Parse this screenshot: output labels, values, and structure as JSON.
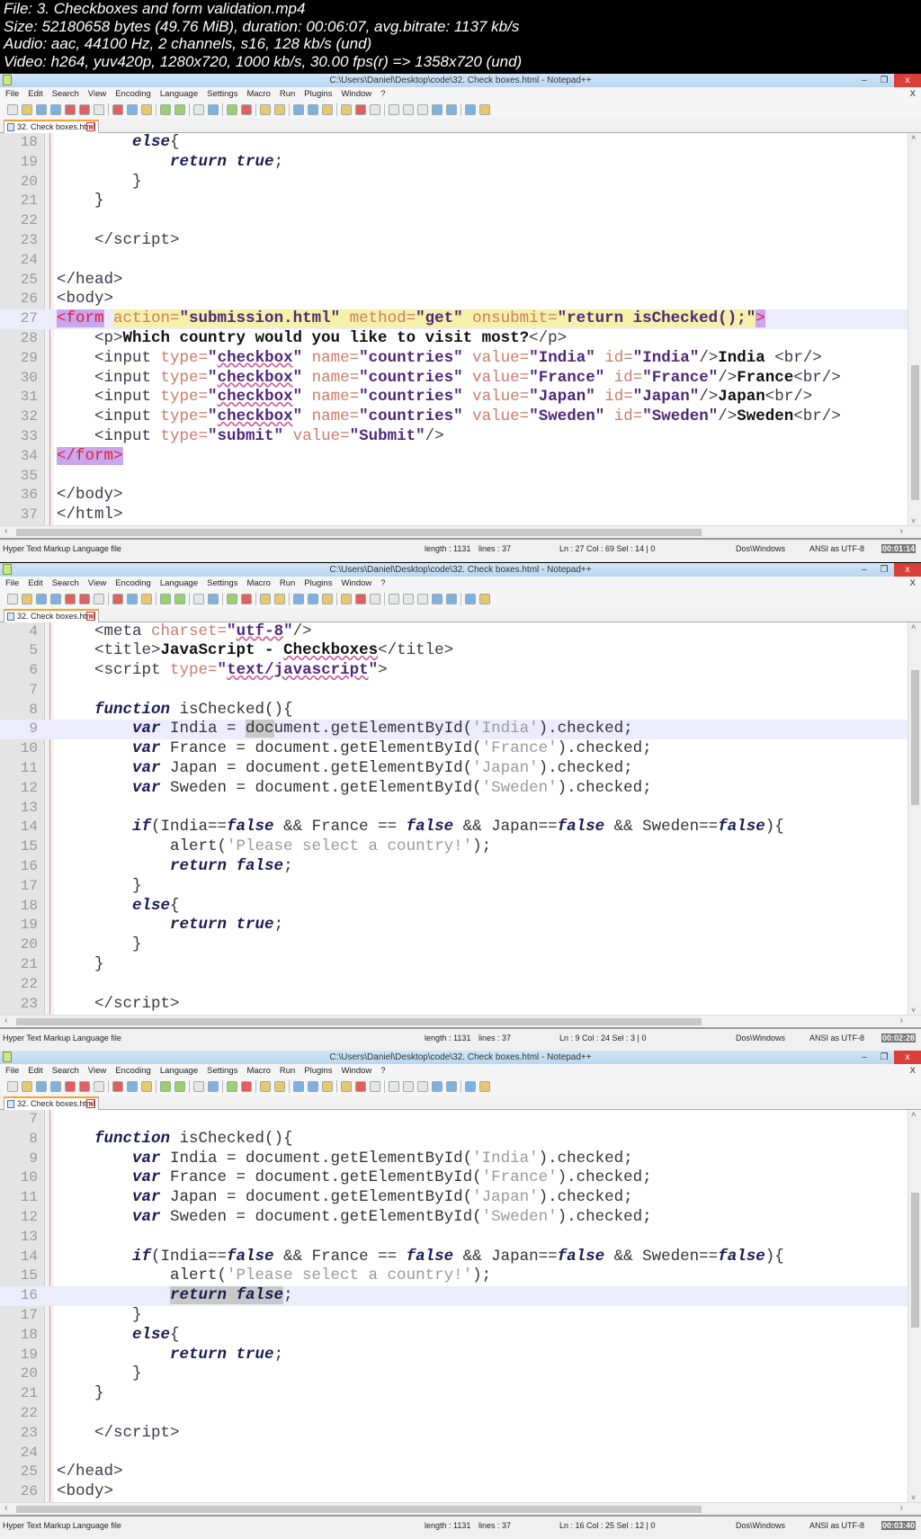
{
  "header": [
    "File: 3. Checkboxes and form validation.mp4",
    "Size: 52180658 bytes (49.76 MiB), duration: 00:06:07, avg.bitrate: 1137 kb/s",
    "Audio: aac, 44100 Hz, 2 channels, s16, 128 kb/s (und)",
    "Video: h264, yuv420p, 1280x720, 1000 kb/s, 30.00 fps(r) => 1358x720 (und)"
  ],
  "window": {
    "title": "C:\\Users\\Daniel\\Desktop\\code\\32. Check boxes.html - Notepad++",
    "minimize": "–",
    "restore": "❐",
    "close": "x",
    "menu": [
      "File",
      "Edit",
      "Search",
      "View",
      "Encoding",
      "Language",
      "Settings",
      "Macro",
      "Run",
      "Plugins",
      "Window",
      "?"
    ],
    "menu_close": "X",
    "tab": "32. Check boxes.html",
    "tab_close": "x"
  },
  "panels": [
    {
      "first_line": 18,
      "current_line": 27,
      "vscroll_fraction": 0.95,
      "status": {
        "type": "Hyper Text Markup Language file",
        "length": "length : 1131",
        "lines": "lines : 37",
        "pos": "Ln : 27   Col : 69   Sel : 14 | 0",
        "eol": "Dos\\Windows",
        "enc": "ANSI as UTF-8",
        "time": "00:01:14"
      },
      "lines": [
        [
          [
            "p",
            "        "
          ],
          [
            "kw",
            "else"
          ],
          [
            "p",
            "{"
          ]
        ],
        [
          [
            "p",
            "            "
          ],
          [
            "kw",
            "return true"
          ],
          [
            "p",
            ";"
          ]
        ],
        [
          [
            "p",
            "        }"
          ]
        ],
        [
          [
            "p",
            "    }"
          ]
        ],
        [],
        [
          [
            "tag",
            "    </script>"
          ]
        ],
        [],
        [
          [
            "tag",
            "</head>"
          ]
        ],
        [
          [
            "tag",
            "<body>"
          ]
        ],
        [
          [
            "tagm",
            "<form"
          ],
          [
            "p",
            " "
          ],
          [
            "attr hl",
            "action="
          ],
          [
            "val hl",
            "\"submission.html\""
          ],
          [
            "hl",
            " "
          ],
          [
            "attr hl",
            "method="
          ],
          [
            "val hl",
            "\"get\""
          ],
          [
            "hl",
            " "
          ],
          [
            "attr hl",
            "onsubmit="
          ],
          [
            "val hl",
            "\"return isChecked();\""
          ],
          [
            "tagm",
            ">"
          ]
        ],
        [
          [
            "tag",
            "    <p>"
          ],
          [
            "txt",
            "Which country would you like to visit most?"
          ],
          [
            "tag",
            "</p>"
          ]
        ],
        [
          [
            "tag",
            "    <input "
          ],
          [
            "attr",
            "type="
          ],
          [
            "val",
            "\""
          ],
          [
            "valu",
            "checkbox"
          ],
          [
            "val",
            "\""
          ],
          [
            "p",
            " "
          ],
          [
            "attr",
            "name="
          ],
          [
            "val",
            "\"countries\""
          ],
          [
            "p",
            " "
          ],
          [
            "attr",
            "value="
          ],
          [
            "val",
            "\"India\""
          ],
          [
            "p",
            " "
          ],
          [
            "attr",
            "id="
          ],
          [
            "val",
            "\"India\""
          ],
          [
            "tag",
            "/>"
          ],
          [
            "txt",
            "India "
          ],
          [
            "tag",
            "<br/>"
          ]
        ],
        [
          [
            "tag",
            "    <input "
          ],
          [
            "attr",
            "type="
          ],
          [
            "val",
            "\""
          ],
          [
            "valu",
            "checkbox"
          ],
          [
            "val",
            "\""
          ],
          [
            "p",
            " "
          ],
          [
            "attr",
            "name="
          ],
          [
            "val",
            "\"countries\""
          ],
          [
            "p",
            " "
          ],
          [
            "attr",
            "value="
          ],
          [
            "val",
            "\"France\""
          ],
          [
            "p",
            " "
          ],
          [
            "attr",
            "id="
          ],
          [
            "val",
            "\"France\""
          ],
          [
            "tag",
            "/>"
          ],
          [
            "txt",
            "France"
          ],
          [
            "tag",
            "<br/>"
          ]
        ],
        [
          [
            "tag",
            "    <input "
          ],
          [
            "attr",
            "type="
          ],
          [
            "val",
            "\""
          ],
          [
            "valu",
            "checkbox"
          ],
          [
            "val",
            "\""
          ],
          [
            "p",
            " "
          ],
          [
            "attr",
            "name="
          ],
          [
            "val",
            "\"countries\""
          ],
          [
            "p",
            " "
          ],
          [
            "attr",
            "value="
          ],
          [
            "val",
            "\"Japan\""
          ],
          [
            "p",
            " "
          ],
          [
            "attr",
            "id="
          ],
          [
            "val",
            "\"Japan\""
          ],
          [
            "tag",
            "/>"
          ],
          [
            "txt",
            "Japan"
          ],
          [
            "tag",
            "<br/>"
          ]
        ],
        [
          [
            "tag",
            "    <input "
          ],
          [
            "attr",
            "type="
          ],
          [
            "val",
            "\""
          ],
          [
            "valu",
            "checkbox"
          ],
          [
            "val",
            "\""
          ],
          [
            "p",
            " "
          ],
          [
            "attr",
            "name="
          ],
          [
            "val",
            "\"countries\""
          ],
          [
            "p",
            " "
          ],
          [
            "attr",
            "value="
          ],
          [
            "val",
            "\"Sweden\""
          ],
          [
            "p",
            " "
          ],
          [
            "attr",
            "id="
          ],
          [
            "val",
            "\"Sweden\""
          ],
          [
            "tag",
            "/>"
          ],
          [
            "txt",
            "Sweden"
          ],
          [
            "tag",
            "<br/>"
          ]
        ],
        [
          [
            "tag",
            "    <input "
          ],
          [
            "attr",
            "type="
          ],
          [
            "val",
            "\"submit\""
          ],
          [
            "p",
            " "
          ],
          [
            "attr",
            "value="
          ],
          [
            "val",
            "\"Submit\""
          ],
          [
            "tag",
            "/>"
          ]
        ],
        [
          [
            "tagm",
            "</form>"
          ]
        ],
        [],
        [
          [
            "tag",
            "</body>"
          ]
        ],
        [
          [
            "tag",
            "</html>"
          ]
        ]
      ]
    },
    {
      "first_line": 4,
      "current_line": 9,
      "vscroll_fraction": 0.15,
      "status": {
        "type": "Hyper Text Markup Language file",
        "length": "length : 1131",
        "lines": "lines : 37",
        "pos": "Ln : 9   Col : 24   Sel : 3 | 0",
        "eol": "Dos\\Windows",
        "enc": "ANSI as UTF-8",
        "time": "00:02:28"
      },
      "lines": [
        [
          [
            "tag",
            "    <meta "
          ],
          [
            "attr",
            "charset="
          ],
          [
            "val",
            "\""
          ],
          [
            "valu",
            "utf-8"
          ],
          [
            "val",
            "\""
          ],
          [
            "tag",
            "/>"
          ]
        ],
        [
          [
            "tag",
            "    <title>"
          ],
          [
            "txt",
            "JavaScript - "
          ],
          [
            "txtu",
            "Checkboxes"
          ],
          [
            "tag",
            "</title>"
          ]
        ],
        [
          [
            "tag",
            "    <script "
          ],
          [
            "attr",
            "type="
          ],
          [
            "val",
            "\""
          ],
          [
            "valu",
            "text/javascript"
          ],
          [
            "val",
            "\""
          ],
          [
            "tag",
            ">"
          ]
        ],
        [],
        [
          [
            "p",
            "    "
          ],
          [
            "kw",
            "function"
          ],
          [
            "p",
            " isChecked(){"
          ]
        ],
        [
          [
            "p",
            "        "
          ],
          [
            "kw",
            "var"
          ],
          [
            "p",
            " India = "
          ],
          [
            "sel",
            "doc"
          ],
          [
            "p",
            "ument.getElementById("
          ],
          [
            "str",
            "'India'"
          ],
          [
            "p",
            ").checked;"
          ]
        ],
        [
          [
            "p",
            "        "
          ],
          [
            "kw",
            "var"
          ],
          [
            "p",
            " France = document.getElementById("
          ],
          [
            "str",
            "'France'"
          ],
          [
            "p",
            ").checked;"
          ]
        ],
        [
          [
            "p",
            "        "
          ],
          [
            "kw",
            "var"
          ],
          [
            "p",
            " Japan = document.getElementById("
          ],
          [
            "str",
            "'Japan'"
          ],
          [
            "p",
            ").checked;"
          ]
        ],
        [
          [
            "p",
            "        "
          ],
          [
            "kw",
            "var"
          ],
          [
            "p",
            " Sweden = document.getElementById("
          ],
          [
            "str",
            "'Sweden'"
          ],
          [
            "p",
            ").checked;"
          ]
        ],
        [],
        [
          [
            "p",
            "        "
          ],
          [
            "kw",
            "if"
          ],
          [
            "p",
            "(India=="
          ],
          [
            "kw",
            "false"
          ],
          [
            "p",
            " && France == "
          ],
          [
            "kw",
            "false"
          ],
          [
            "p",
            " && Japan=="
          ],
          [
            "kw",
            "false"
          ],
          [
            "p",
            " && Sweden=="
          ],
          [
            "kw",
            "false"
          ],
          [
            "p",
            "){"
          ]
        ],
        [
          [
            "p",
            "            alert("
          ],
          [
            "str",
            "'Please select a country!'"
          ],
          [
            "p",
            ");"
          ]
        ],
        [
          [
            "p",
            "            "
          ],
          [
            "kw",
            "return false"
          ],
          [
            "p",
            ";"
          ]
        ],
        [
          [
            "p",
            "        }"
          ]
        ],
        [
          [
            "p",
            "        "
          ],
          [
            "kw",
            "else"
          ],
          [
            "p",
            "{"
          ]
        ],
        [
          [
            "p",
            "            "
          ],
          [
            "kw",
            "return true"
          ],
          [
            "p",
            ";"
          ]
        ],
        [
          [
            "p",
            "        }"
          ]
        ],
        [
          [
            "p",
            "    }"
          ]
        ],
        [],
        [
          [
            "tag",
            "    </script>"
          ]
        ]
      ]
    },
    {
      "first_line": 7,
      "current_line": 16,
      "vscroll_fraction": 0.3,
      "status": {
        "type": "Hyper Text Markup Language file",
        "length": "length : 1131",
        "lines": "lines : 37",
        "pos": "Ln : 16   Col : 25   Sel : 12 | 0",
        "eol": "Dos\\Windows",
        "enc": "ANSI as UTF-8",
        "time": "00:03:40"
      },
      "lines": [
        [],
        [
          [
            "p",
            "    "
          ],
          [
            "kw",
            "function"
          ],
          [
            "p",
            " isChecked(){"
          ]
        ],
        [
          [
            "p",
            "        "
          ],
          [
            "kw",
            "var"
          ],
          [
            "p",
            " India = document.getElementById("
          ],
          [
            "str",
            "'India'"
          ],
          [
            "p",
            ").checked;"
          ]
        ],
        [
          [
            "p",
            "        "
          ],
          [
            "kw",
            "var"
          ],
          [
            "p",
            " France = document.getElementById("
          ],
          [
            "str",
            "'France'"
          ],
          [
            "p",
            ").checked;"
          ]
        ],
        [
          [
            "p",
            "        "
          ],
          [
            "kw",
            "var"
          ],
          [
            "p",
            " Japan = document.getElementById("
          ],
          [
            "str",
            "'Japan'"
          ],
          [
            "p",
            ").checked;"
          ]
        ],
        [
          [
            "p",
            "        "
          ],
          [
            "kw",
            "var"
          ],
          [
            "p",
            " Sweden = document.getElementById("
          ],
          [
            "str",
            "'Sweden'"
          ],
          [
            "p",
            ").checked;"
          ]
        ],
        [],
        [
          [
            "p",
            "        "
          ],
          [
            "kw",
            "if"
          ],
          [
            "p",
            "(India=="
          ],
          [
            "kw",
            "false"
          ],
          [
            "p",
            " && France == "
          ],
          [
            "kw",
            "false"
          ],
          [
            "p",
            " && Japan=="
          ],
          [
            "kw",
            "false"
          ],
          [
            "p",
            " && Sweden=="
          ],
          [
            "kw",
            "false"
          ],
          [
            "p",
            "){"
          ]
        ],
        [
          [
            "p",
            "            alert("
          ],
          [
            "str",
            "'Please select a country!'"
          ],
          [
            "p",
            ");"
          ]
        ],
        [
          [
            "p",
            "            "
          ],
          [
            "kw sel",
            "return false"
          ],
          [
            "p",
            ";"
          ]
        ],
        [
          [
            "p",
            "        }"
          ]
        ],
        [
          [
            "p",
            "        "
          ],
          [
            "kw",
            "else"
          ],
          [
            "p",
            "{"
          ]
        ],
        [
          [
            "p",
            "            "
          ],
          [
            "kw",
            "return true"
          ],
          [
            "p",
            ";"
          ]
        ],
        [
          [
            "p",
            "        }"
          ]
        ],
        [
          [
            "p",
            "    }"
          ]
        ],
        [],
        [
          [
            "tag",
            "    </script>"
          ]
        ],
        [],
        [
          [
            "tag",
            "</head>"
          ]
        ],
        [
          [
            "tag",
            "<body>"
          ]
        ]
      ]
    }
  ]
}
